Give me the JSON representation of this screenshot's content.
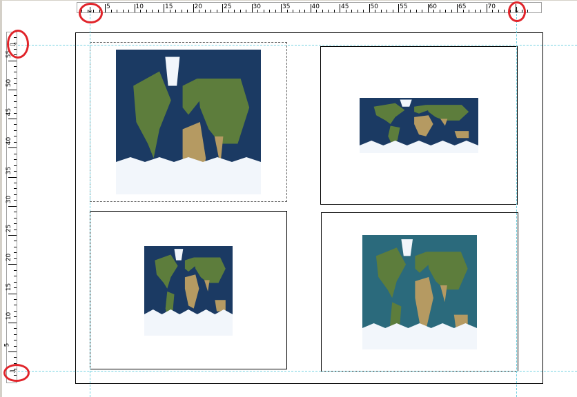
{
  "window": {
    "description_colors": {
      "ocean": "#1b3a63",
      "land": "#5d7d3c",
      "desert": "#b59a62",
      "ice": "#f2f6fb",
      "guide": "#6fd0e0",
      "marker": "#e0242a"
    }
  },
  "ruler": {
    "horizontal_labels": [
      "5",
      "10",
      "15",
      "20",
      "25",
      "30",
      "35",
      "40",
      "45",
      "50",
      "55",
      "60",
      "65",
      "70"
    ],
    "vertical_labels": [
      "55",
      "50",
      "45",
      "40",
      "35",
      "30",
      "25",
      "20",
      "15",
      "10",
      "5"
    ]
  },
  "icons": {
    "guide_handle_top_left": "↓",
    "guide_handle_top_right": "↓",
    "guide_handle_left_top": "⇨",
    "guide_handle_left_bottom": "⇨"
  },
  "maps": [
    {
      "name": "map-frame-top-left",
      "variant": "tall",
      "selected": true
    },
    {
      "name": "map-frame-top-right",
      "variant": "wide",
      "selected": false
    },
    {
      "name": "map-frame-bottom-left",
      "variant": "square",
      "selected": false
    },
    {
      "name": "map-frame-bottom-right",
      "variant": "teal",
      "selected": false
    }
  ]
}
